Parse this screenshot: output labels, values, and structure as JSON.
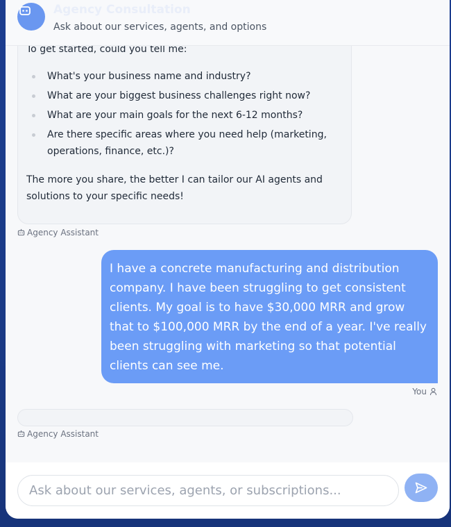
{
  "header": {
    "title": "Agency Consultation",
    "subtitle": "Ask about our services, agents, and options",
    "avatar_icon": "robot-icon"
  },
  "assistant_message": {
    "intro": "To get started, could you tell me:",
    "questions": [
      "What's your business name and industry?",
      "What are your biggest business challenges right now?",
      "What are your main goals for the next 6-12 months?",
      "Are there specific areas where you need help (marketing, operations, finance, etc.)?"
    ],
    "outro": "The more you share, the better I can tailor our AI agents and solutions to your specific needs!",
    "sender": "Agency Assistant"
  },
  "user_message": {
    "text": "I have a concrete manufacturing and distribution company. I have been struggling to get consistent clients. My goal is to have $30,000 MRR and grow that to $100,000 MRR by the end of a year. I've really been struggling with marketing so that potential clients can see me.",
    "sender": "You"
  },
  "pending_message": {
    "sender": "Agency Assistant"
  },
  "input": {
    "placeholder": "Ask about our services, agents, or subscriptions...",
    "value": ""
  },
  "colors": {
    "accent": "#6b9cf6",
    "send_button": "#8fb2f4",
    "background": "#1c3d8f"
  }
}
